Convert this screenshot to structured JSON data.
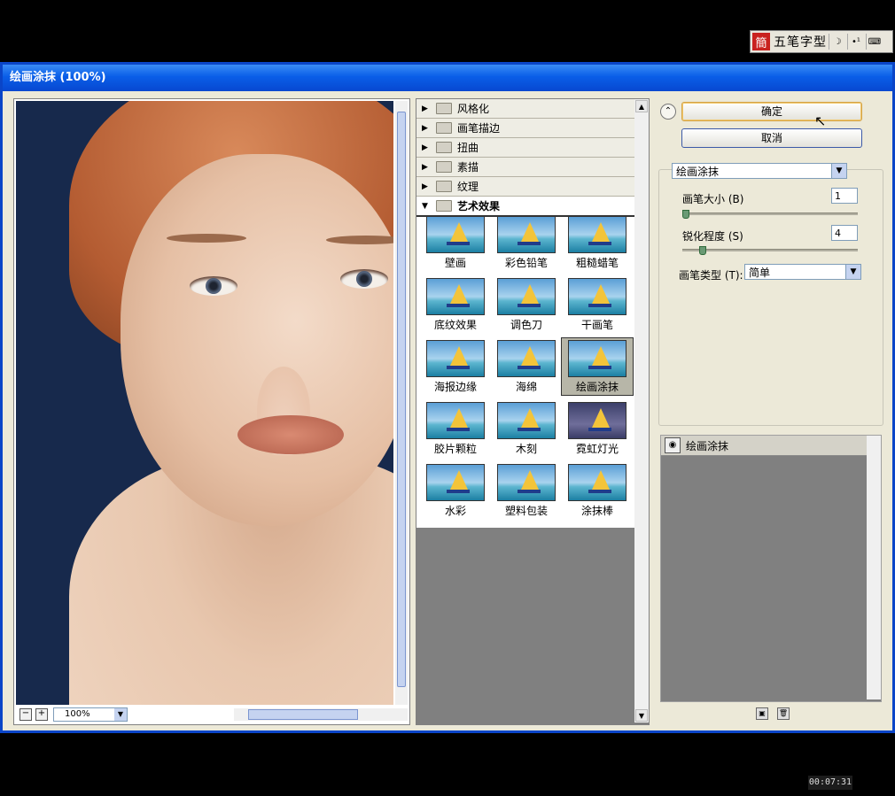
{
  "ime": {
    "logo": "簡",
    "name": "五笔字型",
    "buttons": [
      "☽",
      "•¹",
      "⌨"
    ]
  },
  "dialog": {
    "title": "绘画涂抹 (100%)"
  },
  "preview": {
    "zoom": "100%"
  },
  "gallery": {
    "categories": [
      "风格化",
      "画笔描边",
      "扭曲",
      "素描",
      "纹理"
    ],
    "open_category": "艺术效果",
    "filters": [
      "壁画",
      "彩色铅笔",
      "粗糙蜡笔",
      "底纹效果",
      "调色刀",
      "干画笔",
      "海报边缘",
      "海绵",
      "绘画涂抹",
      "胶片颗粒",
      "木刻",
      "霓虹灯光",
      "水彩",
      "塑料包装",
      "涂抹棒"
    ],
    "selected": "绘画涂抹"
  },
  "buttons": {
    "ok": "确定",
    "cancel": "取消"
  },
  "settings": {
    "filter_select": "绘画涂抹",
    "brush_size_label": "画笔大小 (B)",
    "brush_size_value": "1",
    "brush_size_level": 0.0,
    "sharpness_label": "锐化程度 (S)",
    "sharpness_value": "4",
    "sharpness_level": 0.1,
    "brush_type_label": "画笔类型 (T):",
    "brush_type_value": "简单"
  },
  "layers": {
    "items": [
      "绘画涂抹"
    ]
  },
  "timer": "00:07:31"
}
